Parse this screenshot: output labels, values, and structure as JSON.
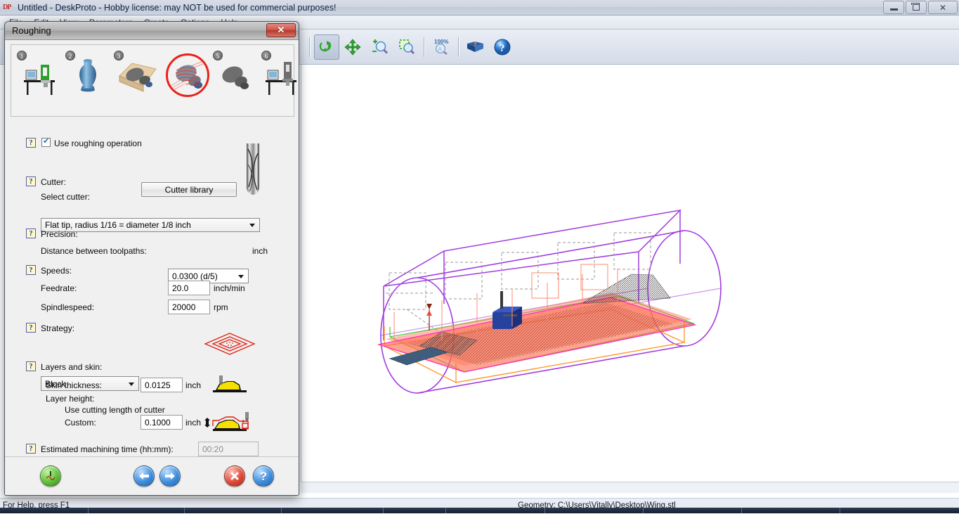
{
  "window": {
    "title": "Untitled - DeskProto - Hobby license: may NOT be used for commercial purposes!",
    "app_icon": "deskproto-icon",
    "minimize_label": "Minimize",
    "maximize_label": "Restore",
    "close_label": "Close"
  },
  "menubar": {
    "items": [
      "File",
      "Edit",
      "View",
      "Parameters",
      "Create",
      "Options",
      "Help"
    ]
  },
  "toolbar": {
    "buttons": [
      {
        "name": "preview-toolpaths",
        "icon": "magnifier-lines-icon",
        "active": false
      },
      {
        "name": "view-camera",
        "icon": "camera-icon",
        "active": false
      },
      {
        "name": "view-top",
        "icon": "cube-top-red-icon",
        "active": false
      },
      {
        "name": "view-front",
        "icon": "cube-front-red-icon",
        "active": false
      },
      {
        "name": "view-right",
        "icon": "cube-right-red-icon",
        "active": false
      },
      {
        "name": "view-bottom",
        "icon": "cube-bottom-red-icon",
        "active": false
      },
      {
        "name": "view-back",
        "icon": "cube-back-red-icon",
        "active": false
      },
      {
        "name": "view-left",
        "icon": "cube-left-red-icon",
        "active": false
      },
      {
        "name": "view-iso",
        "icon": "cube-iso-icon",
        "active": false
      },
      {
        "name": "view-shaded",
        "icon": "cube-shaded-icon",
        "active": false
      },
      {
        "name": "view-restore-camera",
        "icon": "camera-undo-icon",
        "active": false
      },
      {
        "name": "rotate-mode",
        "icon": "rotate-green-icon",
        "active": true
      },
      {
        "name": "pan-mode",
        "icon": "pan-arrows-icon",
        "active": false
      },
      {
        "name": "zoom-in-out",
        "icon": "magnifier-plusminus-icon",
        "active": false
      },
      {
        "name": "zoom-window",
        "icon": "magnifier-marquee-icon",
        "active": false
      },
      {
        "name": "zoom-all",
        "icon": "magnifier-100-icon",
        "active": false
      },
      {
        "name": "manual",
        "icon": "book-help-icon",
        "active": false
      },
      {
        "name": "help",
        "icon": "question-orb-icon",
        "active": false
      }
    ],
    "zoom_all_label": "100%"
  },
  "statusbar": {
    "help_text": "For Help, press F1",
    "geometry_text": "Geometry: C:\\Users\\Vitally\\Desktop\\Wing.stl"
  },
  "dialog": {
    "title": "Roughing",
    "close_glyph": "✕",
    "steps": [
      {
        "num": "1",
        "name": "step-machine-setup",
        "icon": "workbench-green-icon",
        "selected": false
      },
      {
        "num": "2",
        "name": "step-geometry",
        "icon": "blue-vase-icon",
        "selected": false
      },
      {
        "num": "3",
        "name": "step-part",
        "icon": "part-in-block-icon",
        "selected": false
      },
      {
        "num": "4",
        "name": "step-roughing",
        "icon": "roughing-toolpath-icon",
        "selected": true
      },
      {
        "num": "5",
        "name": "step-finishing",
        "icon": "finished-part-icon",
        "selected": false
      },
      {
        "num": "6",
        "name": "step-output",
        "icon": "workbench-machine-icon",
        "selected": false
      }
    ],
    "use_roughing": {
      "label": "Use roughing operation",
      "checked": true,
      "help": "?"
    },
    "cutter": {
      "section_label": "Cutter:",
      "select_label": "Select cutter:",
      "library_button": "Cutter library",
      "selected": "Flat tip, radius 1/16 = diameter 1/8 inch",
      "help": "?",
      "preview_icon": "ball-end-mill-icon"
    },
    "precision": {
      "section_label": "Precision:",
      "distance_label": "Distance between toolpaths:",
      "distance_value": "0.0300  (d/5)",
      "distance_unit": "inch",
      "help": "?"
    },
    "speeds": {
      "section_label": "Speeds:",
      "feedrate_label": "Feedrate:",
      "feedrate_value": "20.0",
      "feedrate_unit": "inch/min",
      "spindlespeed_label": "Spindlespeed:",
      "spindlespeed_value": "20000",
      "spindlespeed_unit": "rpm",
      "help": "?"
    },
    "strategy": {
      "section_label": "Strategy:",
      "value": "Block",
      "help": "?",
      "preview_icon": "block-strategy-diamond-icon"
    },
    "layers": {
      "section_label": "Layers and skin:",
      "skin_label": "Skin thickness:",
      "skin_value": "0.0125",
      "skin_unit": "inch",
      "skin_icon": "skin-thickness-icon",
      "layer_height_label": "Layer height:",
      "use_cutting_length_label": "Use cutting length of cutter",
      "use_cutting_length_selected": false,
      "custom_label": "Custom:",
      "custom_selected": true,
      "custom_value": "0.1000",
      "custom_unit": "inch",
      "custom_icon": "layer-height-icon",
      "help": "?"
    },
    "estimate": {
      "label": "Estimated machining time (hh:mm):",
      "value": "00:20",
      "help": "?"
    },
    "footer": {
      "calculate": {
        "name": "calculate-button",
        "icon": "green-power-toolpath-orb"
      },
      "back": {
        "name": "back-button",
        "icon": "blue-left-arrow-orb"
      },
      "next": {
        "name": "next-button",
        "icon": "blue-right-arrow-orb"
      },
      "cancel": {
        "name": "cancel-button",
        "icon": "red-x-orb"
      },
      "help": {
        "name": "help-button",
        "icon": "blue-question-orb"
      }
    }
  },
  "viewport": {
    "name": "3d-viewport",
    "description": "3D preview of Wing.stl inside a cylindrical stock with roughing toolpaths"
  },
  "colors": {
    "accent_red": "#e8221c",
    "toolpath_red": "#ff6a4d",
    "stock_purple": "#a13ce0",
    "bounds_green": "#44d044",
    "bounds_orange": "#ff9933",
    "magenta": "#ff30c0",
    "help_yellow": "#fdf7c9",
    "help_blue": "#1f2c8f"
  }
}
